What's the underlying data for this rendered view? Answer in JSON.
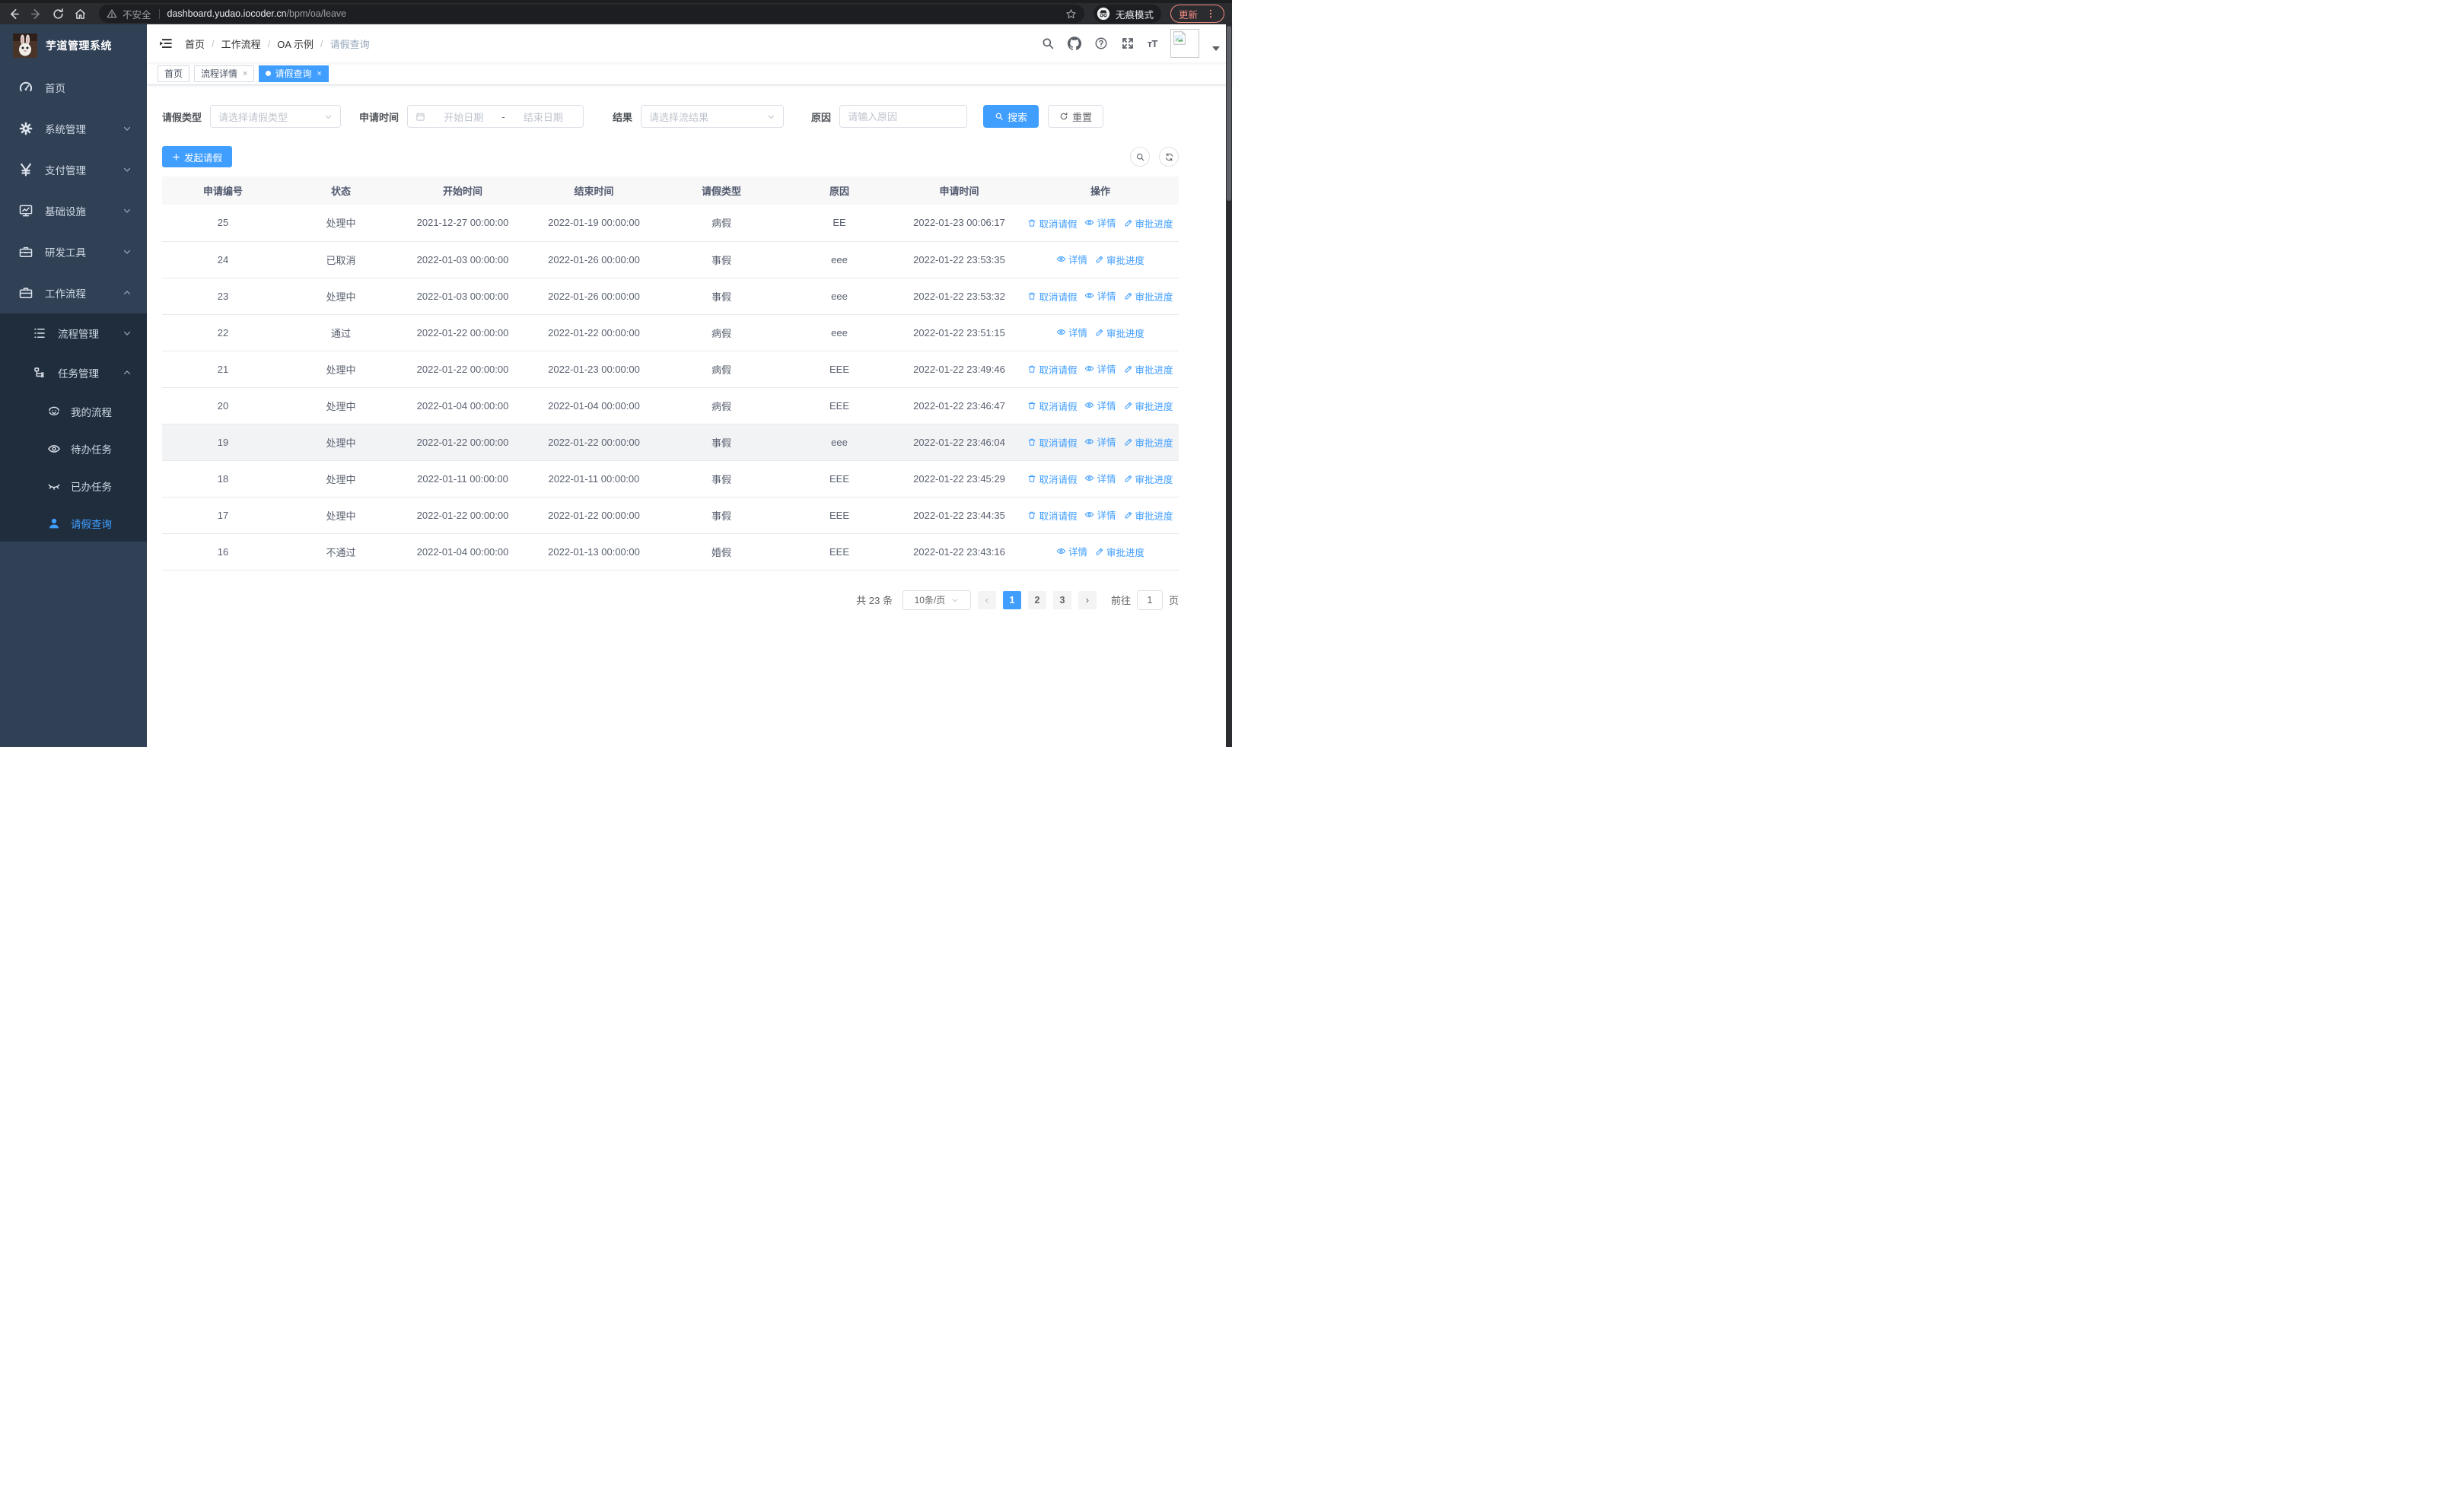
{
  "browser": {
    "security_label": "不安全",
    "url_domain": "dashboard.yudao.iocoder.cn",
    "url_path": "/bpm/oa/leave",
    "incognito_label": "无痕模式",
    "update_label": "更新"
  },
  "sidebar": {
    "title": "芋道管理系统",
    "menu": [
      {
        "label": "首页"
      },
      {
        "label": "系统管理"
      },
      {
        "label": "支付管理"
      },
      {
        "label": "基础设施"
      },
      {
        "label": "研发工具"
      },
      {
        "label": "工作流程"
      }
    ],
    "submenu": [
      {
        "label": "流程管理"
      },
      {
        "label": "任务管理"
      }
    ],
    "tasks": [
      {
        "label": "我的流程"
      },
      {
        "label": "待办任务"
      },
      {
        "label": "已办任务"
      },
      {
        "label": "请假查询"
      }
    ]
  },
  "breadcrumb": [
    "首页",
    "工作流程",
    "OA 示例",
    "请假查询"
  ],
  "tabs": [
    {
      "label": "首页"
    },
    {
      "label": "流程详情"
    },
    {
      "label": "请假查询"
    }
  ],
  "filters": {
    "leave_type_label": "请假类型",
    "leave_type_placeholder": "请选择请假类型",
    "apply_time_label": "申请时间",
    "date_start_placeholder": "开始日期",
    "date_separator": "-",
    "date_end_placeholder": "结束日期",
    "result_label": "结果",
    "result_placeholder": "请选择流结果",
    "reason_label": "原因",
    "reason_placeholder": "请输入原因",
    "search_label": "搜索",
    "reset_label": "重置"
  },
  "toolbar": {
    "create_label": "发起请假"
  },
  "table": {
    "headers": [
      "申请编号",
      "状态",
      "开始时间",
      "结束时间",
      "请假类型",
      "原因",
      "申请时间",
      "操作"
    ],
    "action_labels": {
      "cancel": "取消请假",
      "detail": "详情",
      "progress": "审批进度"
    },
    "rows": [
      {
        "id": "25",
        "status": "处理中",
        "start": "2021-12-27 00:00:00",
        "end": "2022-01-19 00:00:00",
        "type": "病假",
        "reason": "EE",
        "applied": "2022-01-23 00:06:17",
        "can_cancel": true,
        "highlighted": false
      },
      {
        "id": "24",
        "status": "已取消",
        "start": "2022-01-03 00:00:00",
        "end": "2022-01-26 00:00:00",
        "type": "事假",
        "reason": "eee",
        "applied": "2022-01-22 23:53:35",
        "can_cancel": false,
        "highlighted": false
      },
      {
        "id": "23",
        "status": "处理中",
        "start": "2022-01-03 00:00:00",
        "end": "2022-01-26 00:00:00",
        "type": "事假",
        "reason": "eee",
        "applied": "2022-01-22 23:53:32",
        "can_cancel": true,
        "highlighted": false
      },
      {
        "id": "22",
        "status": "通过",
        "start": "2022-01-22 00:00:00",
        "end": "2022-01-22 00:00:00",
        "type": "病假",
        "reason": "eee",
        "applied": "2022-01-22 23:51:15",
        "can_cancel": false,
        "highlighted": false
      },
      {
        "id": "21",
        "status": "处理中",
        "start": "2022-01-22 00:00:00",
        "end": "2022-01-23 00:00:00",
        "type": "病假",
        "reason": "EEE",
        "applied": "2022-01-22 23:49:46",
        "can_cancel": true,
        "highlighted": false
      },
      {
        "id": "20",
        "status": "处理中",
        "start": "2022-01-04 00:00:00",
        "end": "2022-01-04 00:00:00",
        "type": "病假",
        "reason": "EEE",
        "applied": "2022-01-22 23:46:47",
        "can_cancel": true,
        "highlighted": false
      },
      {
        "id": "19",
        "status": "处理中",
        "start": "2022-01-22 00:00:00",
        "end": "2022-01-22 00:00:00",
        "type": "事假",
        "reason": "eee",
        "applied": "2022-01-22 23:46:04",
        "can_cancel": true,
        "highlighted": true
      },
      {
        "id": "18",
        "status": "处理中",
        "start": "2022-01-11 00:00:00",
        "end": "2022-01-11 00:00:00",
        "type": "事假",
        "reason": "EEE",
        "applied": "2022-01-22 23:45:29",
        "can_cancel": true,
        "highlighted": false
      },
      {
        "id": "17",
        "status": "处理中",
        "start": "2022-01-22 00:00:00",
        "end": "2022-01-22 00:00:00",
        "type": "事假",
        "reason": "EEE",
        "applied": "2022-01-22 23:44:35",
        "can_cancel": true,
        "highlighted": false
      },
      {
        "id": "16",
        "status": "不通过",
        "start": "2022-01-04 00:00:00",
        "end": "2022-01-13 00:00:00",
        "type": "婚假",
        "reason": "EEE",
        "applied": "2022-01-22 23:43:16",
        "can_cancel": false,
        "highlighted": false
      }
    ]
  },
  "pagination": {
    "total_label": "共 23 条",
    "page_size_label": "10条/页",
    "pages": [
      "1",
      "2",
      "3"
    ],
    "active_page": "1",
    "goto_label": "前往",
    "goto_value": "1",
    "page_suffix": "页"
  },
  "colors": {
    "accent": "#409eff",
    "sidebar_bg": "#304156",
    "submenu_bg": "#1f2d3d",
    "update_chip": "#f28b82"
  }
}
